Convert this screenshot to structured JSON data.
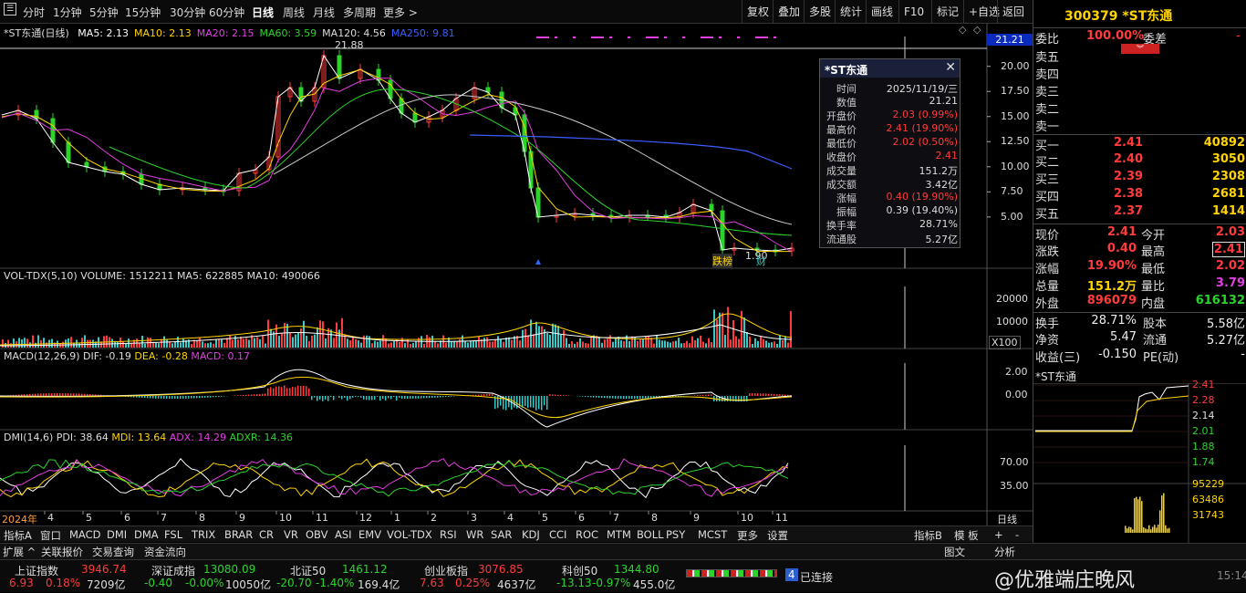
{
  "toolbar": {
    "periods": [
      "分时",
      "1分钟",
      "5分钟",
      "15分钟",
      "30分钟",
      "60分钟",
      "日线",
      "周线",
      "月线",
      "多周期",
      "更多 >"
    ],
    "active": "日线",
    "right_buttons": [
      "复权",
      "叠加",
      "多股",
      "统计",
      "画线",
      "F10",
      "标记",
      "+自选",
      "返回"
    ]
  },
  "main": {
    "name": "*ST东通(日线)",
    "mas": [
      {
        "l": "MA5: 2.13",
        "c": "#ffffff"
      },
      {
        "l": "MA10: 2.13",
        "c": "#ffd400"
      },
      {
        "l": "MA20: 2.15",
        "c": "#e23ee2"
      },
      {
        "l": "MA60: 3.59",
        "c": "#2bd42b"
      },
      {
        "l": "MA120: 4.56",
        "c": "#dddddd"
      },
      {
        "l": "MA250: 9.81",
        "c": "#3c5dff"
      }
    ],
    "yticks": [
      "20.00",
      "17.50",
      "15.00",
      "12.50",
      "10.00",
      "7.50",
      "5.00"
    ],
    "price_tag": "21.21",
    "high_label": "21.88",
    "low_label": "1.90",
    "cursor_marks": [
      "跌榜",
      "财"
    ]
  },
  "vol": {
    "title": "VOL-TDX(5,10)",
    "vals": [
      "VOLUME: 1512211",
      "MA5: 622885",
      "MA10: 490066"
    ],
    "yticks": [
      "20000",
      "10000"
    ],
    "unit": "X100"
  },
  "macd": {
    "title": "MACD(12,26,9)",
    "vals": [
      "DIF: -0.19",
      "DEA: -0.28",
      "MACD: 0.17"
    ],
    "yticks": [
      "2.00",
      "0.00"
    ]
  },
  "dmi": {
    "title": "DMI(14,6)",
    "vals": [
      "PDI: 38.64",
      "MDI: 13.64",
      "ADX: 14.29",
      "ADXR: 14.36"
    ],
    "yticks": [
      "70.00",
      "35.00"
    ]
  },
  "xaxis": {
    "start": "2024年",
    "months": [
      "4",
      "5",
      "6",
      "7",
      "8",
      "9",
      "10",
      "11",
      "12",
      "1",
      "2",
      "3",
      "4",
      "5",
      "6",
      "7",
      "8",
      "9",
      "10",
      "11"
    ],
    "period": "日线"
  },
  "popup": {
    "title": "*ST东通",
    "rows": [
      {
        "k": "时间",
        "v": "2025/11/19/三",
        "c": "#ddd"
      },
      {
        "k": "数值",
        "v": "21.21",
        "c": "#ddd"
      },
      {
        "k": "开盘价",
        "v": "2.03 (0.99%)",
        "c": "#ff3b3b"
      },
      {
        "k": "最高价",
        "v": "2.41 (19.90%)",
        "c": "#ff3b3b"
      },
      {
        "k": "最低价",
        "v": "2.02 (0.50%)",
        "c": "#ff3b3b"
      },
      {
        "k": "收盘价",
        "v": "2.41",
        "c": "#ff3b3b"
      },
      {
        "k": "成交量",
        "v": "151.2万",
        "c": "#ddd"
      },
      {
        "k": "成交额",
        "v": "3.42亿",
        "c": "#ddd"
      },
      {
        "k": "涨幅",
        "v": "0.40 (19.90%)",
        "c": "#ff3b3b"
      },
      {
        "k": "振幅",
        "v": "0.39 (19.40%)",
        "c": "#ddd"
      },
      {
        "k": "换手率",
        "v": "28.71%",
        "c": "#ddd"
      },
      {
        "k": "流通股",
        "v": "5.27亿",
        "c": "#ddd"
      }
    ]
  },
  "quote": {
    "code_name": "300379 *ST东通",
    "webi_label": "委比",
    "webi": "100.00%",
    "weicha_label": "委差",
    "weicha": "-",
    "sells": [
      "卖五",
      "卖四",
      "卖三",
      "卖二",
      "卖一"
    ],
    "buys": [
      {
        "l": "买一",
        "p": "2.41",
        "v": "40892"
      },
      {
        "l": "买二",
        "p": "2.40",
        "v": "3050"
      },
      {
        "l": "买三",
        "p": "2.39",
        "v": "2308"
      },
      {
        "l": "买四",
        "p": "2.38",
        "v": "2681"
      },
      {
        "l": "买五",
        "p": "2.37",
        "v": "1414"
      }
    ],
    "stats": [
      {
        "a": "现价",
        "av": "2.41",
        "ac": "#ff3b3b",
        "b": "今开",
        "bv": "2.03",
        "bc": "#ff3b3b"
      },
      {
        "a": "涨跌",
        "av": "0.40",
        "ac": "#ff3b3b",
        "b": "最高",
        "bv": "2.41",
        "bc": "#ff3b3b"
      },
      {
        "a": "涨幅",
        "av": "19.90%",
        "ac": "#ff3b3b",
        "b": "最低",
        "bv": "2.02",
        "bc": "#ff3b3b"
      },
      {
        "a": "总量",
        "av": "151.2万",
        "ac": "#ffd400",
        "b": "量比",
        "bv": "3.79",
        "bc": "#e23ee2"
      },
      {
        "a": "外盘",
        "av": "896079",
        "ac": "#ff3b3b",
        "b": "内盘",
        "bv": "616132",
        "bc": "#2bd42b"
      }
    ],
    "stats2": [
      {
        "a": "换手",
        "av": "28.71%",
        "b": "股本",
        "bv": "5.58亿"
      },
      {
        "a": "净资",
        "av": "5.47",
        "b": "流通",
        "bv": "5.27亿"
      },
      {
        "a": "收益(三)",
        "av": "-0.150",
        "b": "PE(动)",
        "bv": "-"
      }
    ],
    "mini_title": "*ST东通",
    "mini_prices": [
      "2.41",
      "2.28",
      "2.14",
      "2.01",
      "1.88",
      "1.74"
    ],
    "mini_vols": [
      "95229",
      "63486",
      "31743"
    ]
  },
  "indicators": [
    "指标A",
    "窗口",
    "MACD",
    "DMI",
    "DMA",
    "FSL",
    "TRIX",
    "BRAR",
    "CR",
    "VR",
    "OBV",
    "ASI",
    "EMV",
    "VOL-TDX",
    "RSI",
    "WR",
    "SAR",
    "KDJ",
    "CCI",
    "ROC",
    "MTM",
    "BOLL",
    "PSY",
    "MCST",
    "更多",
    "设置"
  ],
  "ind_right": [
    "指标B",
    "模 板",
    "+",
    "-"
  ],
  "extras": [
    "扩展 ^",
    "关联报价",
    "交易查询",
    "资金流向"
  ],
  "mini_tabs": [
    "图文",
    "分析"
  ],
  "watermark": "@优雅端庄晚风",
  "status": [
    {
      "n": "上证指数",
      "v": "3946.74",
      "c1": "6.93",
      "c2": "0.18%",
      "amt": "7209亿",
      "col": "#ff3b3b"
    },
    {
      "n": "深证成指",
      "v": "13080.09",
      "c1": "-0.40",
      "c2": "-0.00%",
      "amt": "10050亿",
      "col": "#2bd42b"
    },
    {
      "n": "北证50",
      "v": "1461.12",
      "c1": "-20.70",
      "c2": "-1.40%",
      "amt": "169.4亿",
      "col": "#2bd42b"
    },
    {
      "n": "创业板指",
      "v": "3076.85",
      "c1": "7.63",
      "c2": "0.25%",
      "amt": "4637亿",
      "col": "#ff3b3b"
    },
    {
      "n": "科创50",
      "v": "1344.80",
      "c1": "-13.13",
      "c2": "-0.97%",
      "amt": "455.0亿",
      "col": "#2bd42b"
    }
  ],
  "conn": {
    "num": "4",
    "text": "已连接",
    "time": "15:14"
  }
}
